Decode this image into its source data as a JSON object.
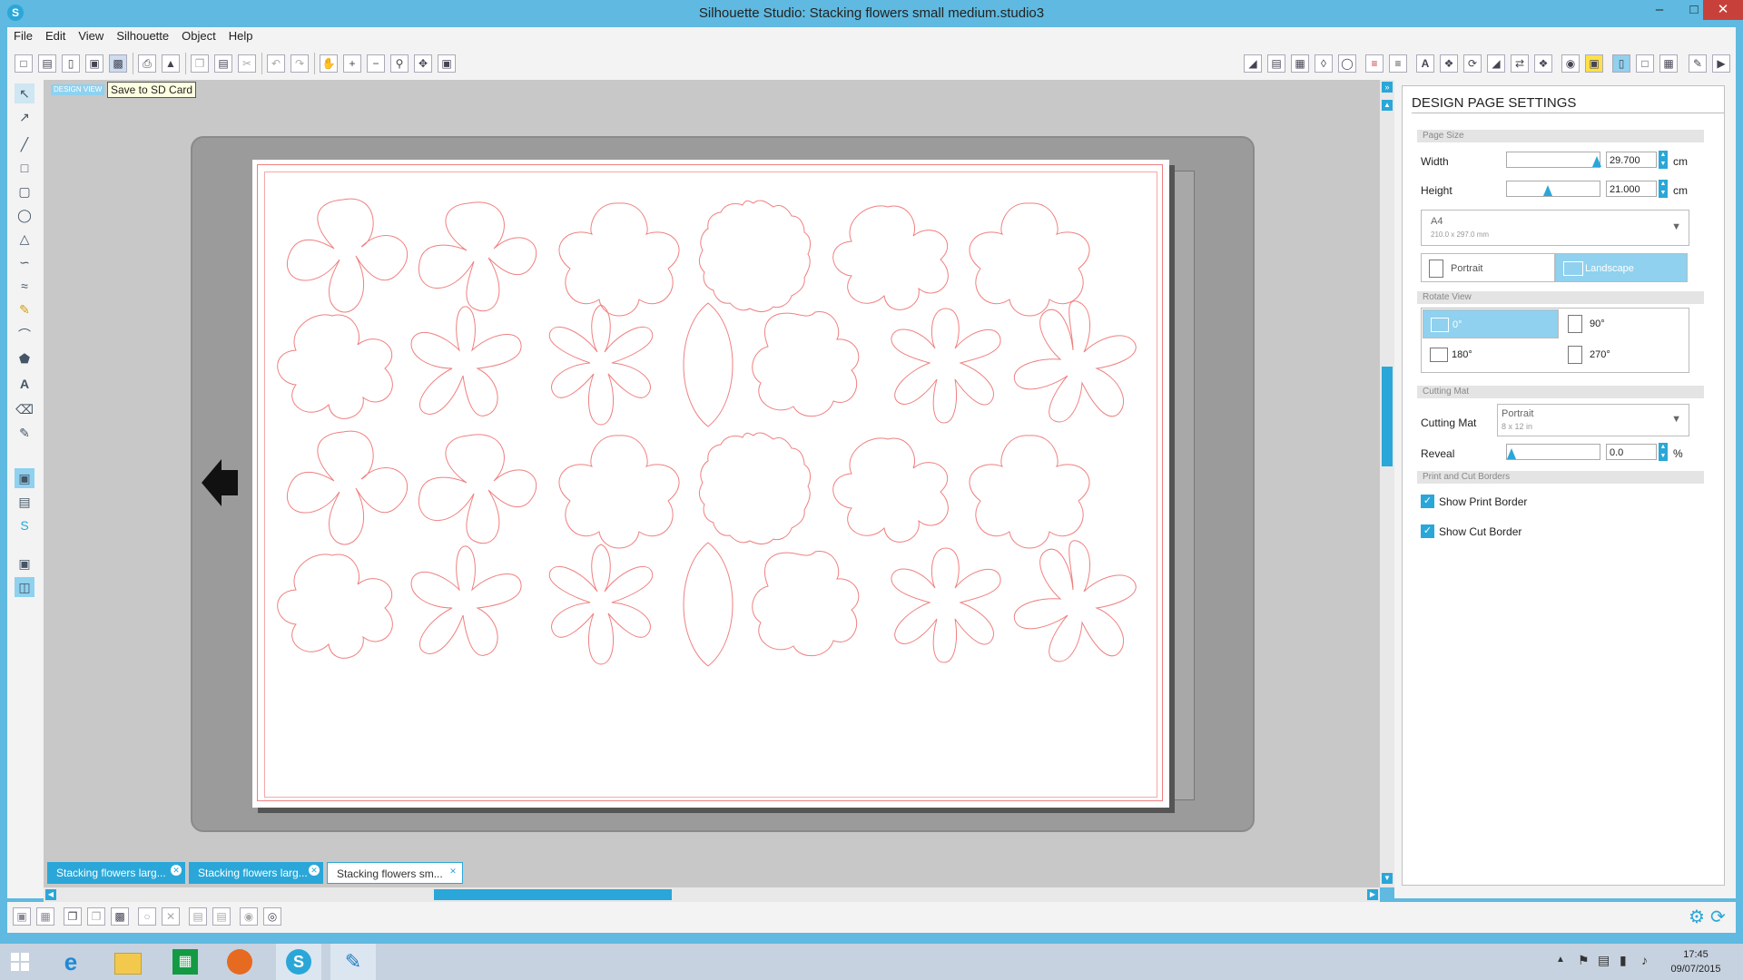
{
  "window": {
    "title": "Silhouette Studio: Stacking flowers small medium.studio3"
  },
  "menu": [
    "File",
    "Edit",
    "View",
    "Silhouette",
    "Object",
    "Help"
  ],
  "tooltip": "Save to SD Card",
  "design_view_label": "DESIGN VIEW",
  "tabs": [
    {
      "label": "Stacking flowers larg...",
      "active": false
    },
    {
      "label": "Stacking flowers larg...",
      "active": false
    },
    {
      "label": "Stacking flowers sm...",
      "active": true
    }
  ],
  "panel": {
    "title": "DESIGN PAGE SETTINGS",
    "page_size": {
      "section": "Page Size",
      "width_label": "Width",
      "width_value": "29.700",
      "width_unit": "cm",
      "height_label": "Height",
      "height_value": "21.000",
      "height_unit": "cm",
      "paper_name": "A4",
      "paper_dims": "210.0 x 297.0 mm",
      "portrait_label": "Portrait",
      "landscape_label": "Landscape"
    },
    "rotate_view": {
      "section": "Rotate View",
      "r0": "0°",
      "r90": "90°",
      "r180": "180°",
      "r270": "270°"
    },
    "cutting_mat": {
      "section": "Cutting Mat",
      "label": "Cutting Mat",
      "value": "Portrait",
      "sub": "8 x 12 in",
      "reveal_label": "Reveal",
      "reveal_value": "0.0",
      "reveal_unit": "%"
    },
    "borders": {
      "section": "Print and Cut Borders",
      "show_print": "Show Print Border",
      "show_cut": "Show Cut Border"
    }
  },
  "clock": {
    "time": "17:45",
    "date": "09/07/2015"
  },
  "colors": {
    "accent": "#2aa7d8",
    "cut_line": "#f08080",
    "title_bar": "#5fb9e0"
  }
}
